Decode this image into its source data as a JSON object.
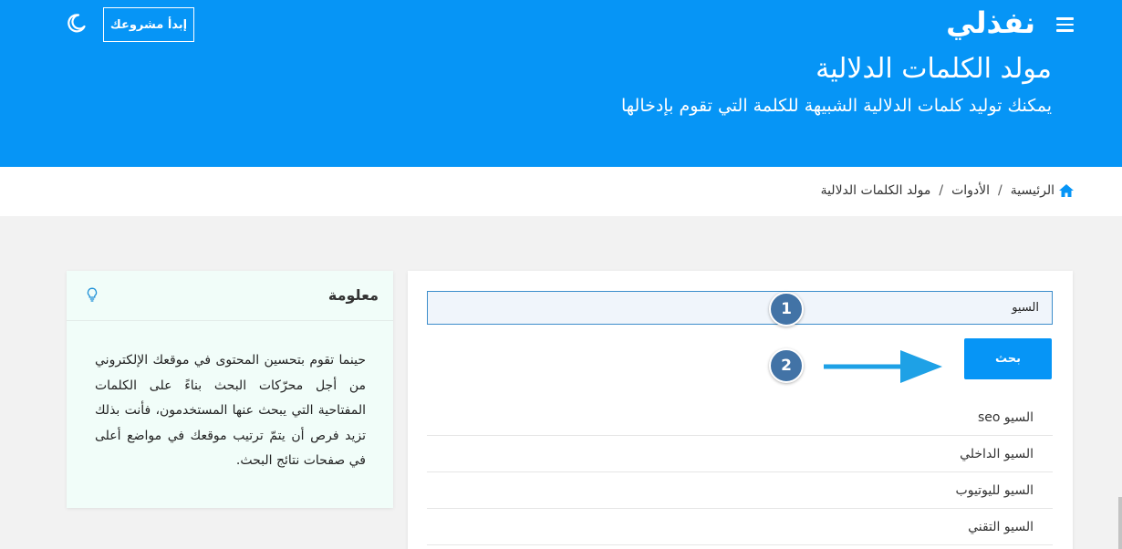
{
  "header": {
    "logo": "نفذلي",
    "start_button": "إبدأ مشروعك",
    "title": "مولد الكلمات الدلالية",
    "subtitle": "يمكنك توليد كلمات الدلالية الشبيهة للكلمة التي تقوم بإدخالها"
  },
  "breadcrumb": {
    "home": "الرئيسية",
    "tools": "الأدوات",
    "current": "مولد الكلمات الدلالية",
    "separator": "/"
  },
  "tool": {
    "search_value": "السيو",
    "search_button": "بحث",
    "results": [
      "السيو seo",
      "السيو الداخلي",
      "السيو لليوتيوب",
      "السيو التقني"
    ]
  },
  "annotations": {
    "marker_1": "1",
    "marker_2": "2"
  },
  "info": {
    "title": "معلومة",
    "text": "حينما تقوم بتحسين المحتوى في موقعك الإلكتروني من أجل محرّكات البحث بناءً على الكلمات المفتاحية التي يبحث عنها المستخدمون، فأنت بذلك تزيد فرص أن يتمّ ترتيب موقعك في مواضع أعلى في صفحات نتائج البحث."
  },
  "icons": {
    "menu": "menu-icon",
    "moon": "moon-icon",
    "home": "home-icon",
    "bulb": "lightbulb-icon"
  },
  "colors": {
    "primary": "#0695f6",
    "marker": "#4273a6",
    "arrow": "#1ea1e6",
    "info_bg": "#f1fdf9"
  }
}
